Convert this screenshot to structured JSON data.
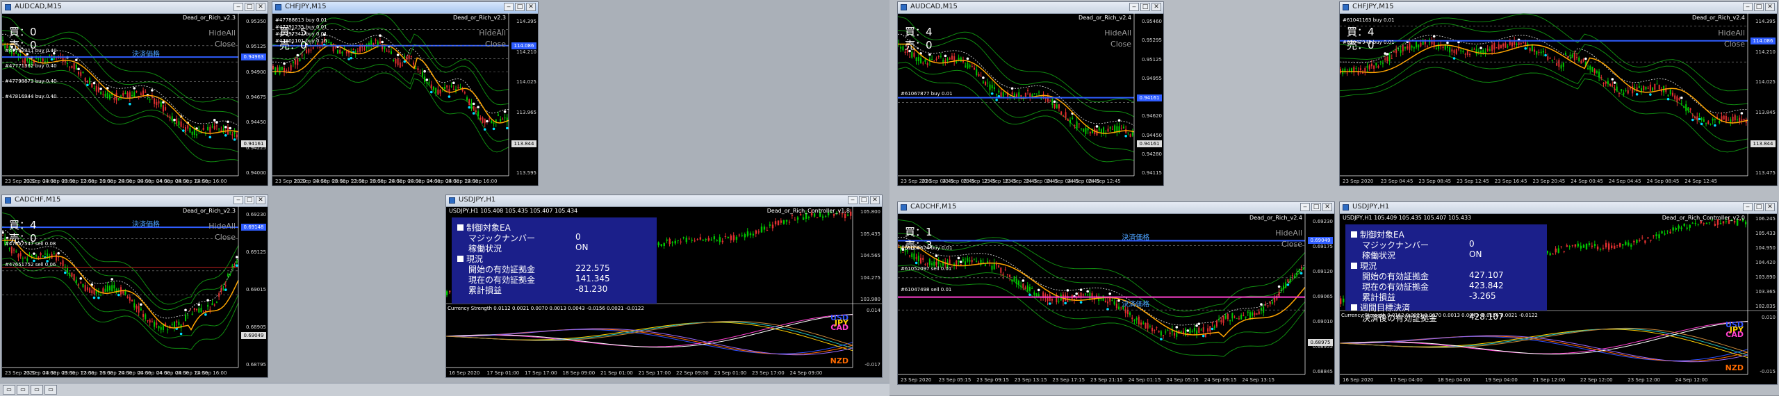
{
  "windows": [
    {
      "title": "AUDCAD,M15",
      "ea": "Dead_or_Rich_v2.3",
      "buy": "買：0",
      "sell": "売：0",
      "hideall": "HideAll",
      "close": "Close",
      "level_label": "決済価格",
      "orders": [
        "#47742311 buy 0.40",
        "#47771362 buy 0.40",
        "#47798873 buy 0.40",
        "#47816944 buy 0.40"
      ],
      "y_ticks": [
        "0.95350",
        "0.95125",
        "0.94900",
        "0.94675",
        "0.94450",
        "0.94225",
        "0.94000"
      ],
      "x_ticks": [
        "23 Sep 2020",
        "23 Sep 04:00",
        "23 Sep 08:00",
        "23 Sep 12:00",
        "23 Sep 16:00",
        "23 Sep 20:00",
        "24 Sep 00:00",
        "24 Sep 04:00",
        "24 Sep 08:00",
        "24 Sep 12:00",
        "24 Sep 16:00"
      ],
      "price_chip": "0.94963",
      "price_chip2": "0.94161"
    },
    {
      "title": "CHFJPY,M15",
      "ea": "Dead_or_Rich_v2.3",
      "buy": "買：5",
      "sell": "売：0",
      "hideall": "HideAll",
      "close": "Close",
      "orders": [
        "#47788613 buy 0.01",
        "#47791235 buy 0.01",
        "#47797341 buy 0.01",
        "#47801101 buy 0.16"
      ],
      "y_ticks": [
        "114.395",
        "114.210",
        "114.025",
        "113.965",
        "113.780",
        "113.595"
      ],
      "x_ticks": [
        "23 Sep 2020",
        "23 Sep 04:00",
        "23 Sep 08:00",
        "23 Sep 12:00",
        "23 Sep 16:00",
        "23 Sep 20:00",
        "24 Sep 00:00",
        "24 Sep 04:00",
        "24 Sep 08:00",
        "24 Sep 12:00",
        "24 Sep 16:00"
      ],
      "price_chip": "114.086",
      "price_chip2": "113.844"
    },
    {
      "title": "AUDCAD,M15",
      "ea": "Dead_or_Rich_v2.4",
      "buy": "買：4",
      "sell": "売：0",
      "hideall": "HideAll",
      "close": "Close",
      "orders": [
        "#61067877 buy 0.01"
      ],
      "y_ticks": [
        "0.95460",
        "0.95295",
        "0.95125",
        "0.94955",
        "0.94785",
        "0.94620",
        "0.94450",
        "0.94280",
        "0.94115"
      ],
      "x_ticks": [
        "23 Sep 2020",
        "23 Sep 04:45",
        "23 Sep 08:45",
        "23 Sep 12:45",
        "23 Sep 16:45",
        "23 Sep 20:45",
        "24 Sep 00:45",
        "24 Sep 04:45",
        "24 Sep 08:45",
        "24 Sep 12:45"
      ],
      "price_chip": "0.94161",
      "price_chip2": "0.94161"
    },
    {
      "title": "CHFJPY,M15",
      "ea": "Dead_or_Rich_v2.4",
      "buy": "買：4",
      "sell": "売：0",
      "hideall": "HideAll",
      "close": "Close",
      "orders": [
        "#61041163 buy 0.01",
        "#61047945 buy 0.01"
      ],
      "y_ticks": [
        "114.395",
        "114.210",
        "114.025",
        "113.845",
        "113.660",
        "113.475"
      ],
      "x_ticks": [
        "23 Sep 2020",
        "23 Sep 04:45",
        "23 Sep 08:45",
        "23 Sep 12:45",
        "23 Sep 16:45",
        "23 Sep 20:45",
        "24 Sep 00:45",
        "24 Sep 04:45",
        "24 Sep 08:45",
        "24 Sep 12:45"
      ],
      "price_chip": "114.086",
      "price_chip2": "113.844"
    },
    {
      "title": "CADCHF,M15",
      "ea": "Dead_or_Rich_v2.3",
      "buy": "買：4",
      "sell": "売：0",
      "hideall": "HideAll",
      "close": "Close",
      "level_label": "決済価格",
      "orders": [
        "#47657547 sell 0.08",
        "#47651752 sell 0.06"
      ],
      "y_ticks": [
        "0.69230",
        "0.69125",
        "0.69015",
        "0.68905",
        "0.68795"
      ],
      "x_ticks": [
        "23 Sep 2020",
        "23 Sep 04:00",
        "23 Sep 08:00",
        "23 Sep 12:00",
        "23 Sep 16:00",
        "23 Sep 20:00",
        "24 Sep 00:00",
        "24 Sep 04:00",
        "24 Sep 08:00",
        "24 Sep 12:00",
        "24 Sep 16:00"
      ],
      "price_chip": "0.69148",
      "price_chip2": "0.69049"
    },
    {
      "title": "USDJPY,H1",
      "quote": "USDJPY,H1  105.408 105.435 105.407 105.434",
      "ea": "Dead_or_Rich_Controller_v1.8",
      "panel": {
        "h1": "制御対象EA",
        "magic_k": "マジックナンバー",
        "magic_v": "0",
        "run_k": "稼働状況",
        "run_v": "ON",
        "h2": "現況",
        "start_k": "開始の有効証拠金",
        "start_v": "222.575",
        "cur_k": "現在の有効証拠金",
        "cur_v": "141.345",
        "pl_k": "累計損益",
        "pl_v": "-81.230"
      },
      "strength": "Currency Strength 0.0112 0.0021 0.0070 0.0013 0.0043 -0.0156 0.0021 -0.0122",
      "ccy": [
        "USD",
        "JPY",
        "CAD",
        "NZD"
      ],
      "y_ticks": [
        "105.800",
        "105.435",
        "104.565",
        "104.275",
        "103.980"
      ],
      "sub_y": [
        "0.014",
        "-0.017"
      ],
      "x_ticks": [
        "16 Sep 2020",
        "17 Sep 01:00",
        "17 Sep 17:00",
        "18 Sep 09:00",
        "21 Sep 01:00",
        "21 Sep 17:00",
        "22 Sep 09:00",
        "23 Sep 01:00",
        "23 Sep 17:00",
        "24 Sep 09:00"
      ]
    },
    {
      "title": "CADCHF,M15",
      "ea": "Dead_or_Rich_v2.4",
      "buy": "買：1",
      "sell": "売：3",
      "hideall": "HideAll",
      "close": "Close",
      "level_label": "決済価格",
      "level_label2": "決済価格",
      "orders": [
        "#61059674 buy 0.01",
        "#61052097 sell 0.01",
        "#61047498 sell 0.01"
      ],
      "y_ticks": [
        "0.69230",
        "0.69175",
        "0.69120",
        "0.69065",
        "0.69010",
        "0.68955",
        "0.68845"
      ],
      "x_ticks": [
        "23 Sep 2020",
        "23 Sep 05:15",
        "23 Sep 09:15",
        "23 Sep 13:15",
        "23 Sep 17:15",
        "23 Sep 21:15",
        "24 Sep 01:15",
        "24 Sep 05:15",
        "24 Sep 09:15",
        "24 Sep 13:15"
      ],
      "price_chip": "0.69049",
      "price_chip2": "0.68975"
    },
    {
      "title": "USDJPY,H1",
      "quote": "USDJPY,H1  105.409 105.435 105.407 105.433",
      "ea": "Dead_or_Rich_Controller_v2.0",
      "panel": {
        "h1": "制御対象EA",
        "magic_k": "マジックナンバー",
        "magic_v": "0",
        "run_k": "稼働状況",
        "run_v": "ON",
        "h2": "現況",
        "start_k": "開始の有効証拠金",
        "start_v": "427.107",
        "cur_k": "現在の有効証拠金",
        "cur_v": "423.842",
        "pl_k": "累計損益",
        "pl_v": "-3.265",
        "h3": "週間目標決済",
        "goal_k": "決済後の有効証拠金",
        "goal_v": "428.107"
      },
      "strength": "Currency Strength 0.0112 0.0021 0.0070 0.0013 0.0043 -0.0156 0.0021 -0.0122",
      "ccy": [
        "USD",
        "JPY",
        "CAD",
        "NZD"
      ],
      "y_ticks": [
        "106.245",
        "105.433",
        "104.950",
        "104.420",
        "103.890",
        "103.365",
        "102.835"
      ],
      "sub_y": [
        "0.010",
        "-0.015"
      ],
      "x_ticks": [
        "16 Sep 2020",
        "17 Sep 04:00",
        "18 Sep 04:00",
        "19 Sep 04:00",
        "21 Sep 12:00",
        "22 Sep 12:00",
        "23 Sep 12:00",
        "24 Sep 12:00"
      ]
    }
  ],
  "colors": {
    "bull": "#00c800",
    "bear": "#e03030",
    "band": "#108a10",
    "ma": "#ffa500",
    "blue_line": "#2f5dff",
    "magenta": "#ff40d0"
  }
}
